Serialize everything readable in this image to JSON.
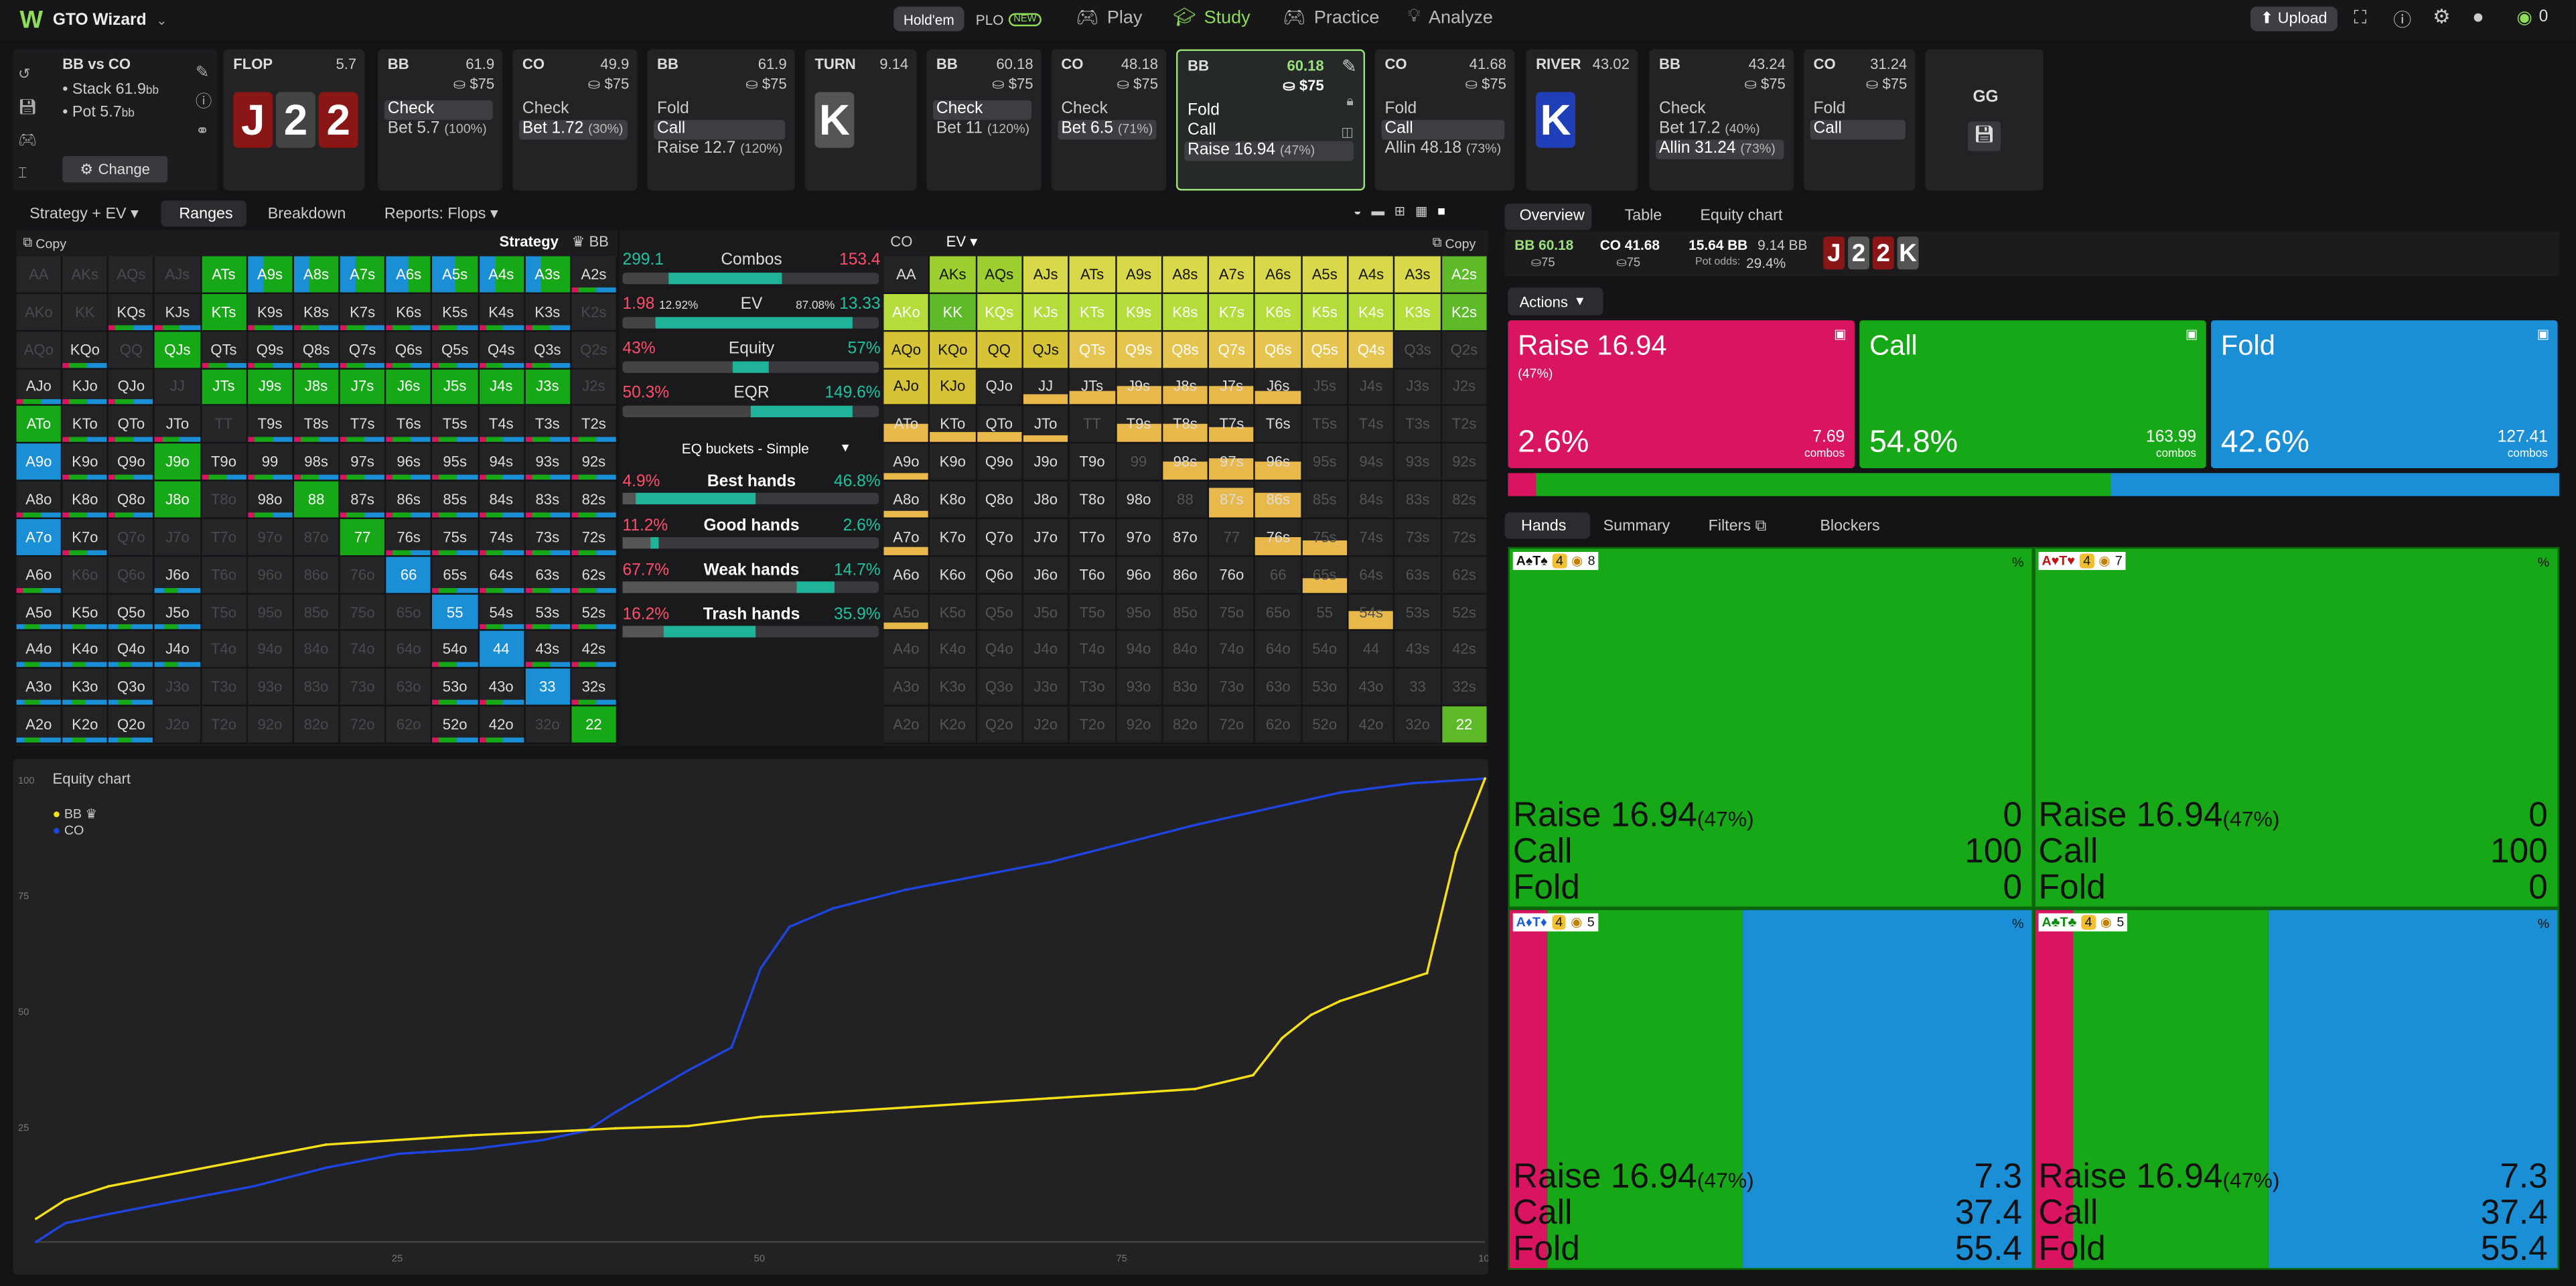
{
  "app": {
    "logo": "W",
    "name": "GTO Wizard",
    "variants": [
      "Hold'em",
      "PLO"
    ],
    "plo_badge": "NEW",
    "nav": [
      "Play",
      "Study",
      "Practice",
      "Analyze"
    ],
    "upload": "Upload",
    "user_count": "0"
  },
  "spot": {
    "title": "BB vs CO",
    "stack": "• Stack 61.9",
    "stack_unit": "bb",
    "pot": "• Pot 5.7",
    "pot_unit": "bb",
    "change": "Change"
  },
  "strip": [
    {
      "h": "FLOP",
      "v": "5.7",
      "board": [
        "J",
        "2",
        "2"
      ],
      "board_colors": [
        "#8b1616",
        "#444",
        "#8b1616"
      ]
    },
    {
      "h": "BB",
      "v": "61.9",
      "pot": "$75",
      "acts": [
        [
          "Check",
          "",
          true
        ],
        [
          "Bet 5.7",
          "(100%)",
          false
        ]
      ]
    },
    {
      "h": "CO",
      "v": "49.9",
      "pot": "$75",
      "acts": [
        [
          "Check",
          "",
          false
        ],
        [
          "Bet 1.72",
          "(30%)",
          true
        ]
      ]
    },
    {
      "h": "BB",
      "v": "61.9",
      "pot": "$75",
      "acts": [
        [
          "Fold",
          "",
          false
        ],
        [
          "Call",
          "",
          true
        ],
        [
          "Raise 12.7",
          "(120%)",
          false
        ]
      ]
    },
    {
      "h": "TURN",
      "v": "9.14",
      "board": [
        "K"
      ],
      "board_colors": [
        "#555"
      ]
    },
    {
      "h": "BB",
      "v": "60.18",
      "pot": "$75",
      "acts": [
        [
          "Check",
          "",
          true
        ],
        [
          "Bet 11",
          "(120%)",
          false
        ]
      ]
    },
    {
      "h": "CO",
      "v": "48.18",
      "pot": "$75",
      "acts": [
        [
          "Check",
          "",
          false
        ],
        [
          "Bet 6.5",
          "(71%)",
          true
        ]
      ]
    },
    {
      "h": "BB",
      "v": "60.18",
      "pot": "$75",
      "acts": [
        [
          "Fold",
          "",
          false
        ],
        [
          "Call",
          "",
          false
        ],
        [
          "Raise 16.94",
          "(47%)",
          true
        ]
      ],
      "sel": true
    },
    {
      "h": "CO",
      "v": "41.68",
      "pot": "$75",
      "acts": [
        [
          "Fold",
          "",
          false
        ],
        [
          "Call",
          "",
          true
        ],
        [
          "Allin 48.18",
          "(73%)",
          false
        ]
      ]
    },
    {
      "h": "RIVER",
      "v": "43.02",
      "board": [
        "K"
      ],
      "board_colors": [
        "#1f3fb8"
      ]
    },
    {
      "h": "BB",
      "v": "43.24",
      "pot": "$75",
      "acts": [
        [
          "Check",
          "",
          false
        ],
        [
          "Bet 17.2",
          "(40%)",
          false
        ],
        [
          "Allin 31.24",
          "(73%)",
          true
        ]
      ]
    },
    {
      "h": "CO",
      "v": "31.24",
      "pot": "$75",
      "acts": [
        [
          "Fold",
          "",
          false
        ],
        [
          "Call",
          "",
          true
        ]
      ]
    },
    {
      "h": "GG",
      "v": "",
      "board": []
    }
  ],
  "left_tabs": {
    "mode": "Strategy + EV",
    "tabs": [
      "Ranges",
      "Breakdown",
      "Reports: Flops"
    ]
  },
  "grid_left": {
    "copy": "Copy",
    "mode": "Strategy",
    "player": "BB"
  },
  "grid_right": {
    "player": "CO",
    "mode": "EV",
    "copy": "Copy"
  },
  "stats": [
    {
      "l": "299.1",
      "m": "Combos",
      "r": "153.4",
      "lc": "#1fc3a0",
      "rc": "#ff4d6a"
    },
    {
      "l": "1.98",
      "lp": "12.92%",
      "m": "EV",
      "rp": "87.08%",
      "r": "13.33",
      "lc": "#ff4d6a",
      "rc": "#1fc3a0"
    },
    {
      "l": "43%",
      "m": "Equity",
      "r": "57%",
      "lc": "#ff4d6a",
      "rc": "#1fc3a0"
    },
    {
      "l": "50.3%",
      "m": "EQR",
      "r": "149.6%",
      "lc": "#ff4d6a",
      "rc": "#1fc3a0"
    }
  ],
  "buckets": {
    "title": "EQ buckets - Simple",
    "rows": [
      [
        "4.9%",
        "Best hands",
        "46.8%"
      ],
      [
        "11.2%",
        "Good hands",
        "2.6%"
      ],
      [
        "67.7%",
        "Weak hands",
        "14.7%"
      ],
      [
        "16.2%",
        "Trash hands",
        "35.9%"
      ]
    ]
  },
  "equity_chart": {
    "title": "Equity chart",
    "legend": [
      "BB",
      "CO"
    ],
    "yticks": [
      "100",
      "75",
      "50",
      "25"
    ],
    "xticks": [
      "25",
      "50",
      "75",
      "100"
    ]
  },
  "chart_data": {
    "type": "line",
    "title": "Equity chart",
    "series": [
      {
        "name": "BB",
        "color": "#f5e016",
        "x": [
          0,
          2,
          5,
          10,
          15,
          20,
          30,
          37,
          40,
          45,
          50,
          55,
          60,
          70,
          75,
          80,
          84,
          86,
          88,
          90,
          96,
          98,
          100
        ],
        "y": [
          5,
          9,
          12,
          15,
          18,
          21,
          23,
          24,
          24.5,
          25,
          27,
          28,
          29,
          31,
          32,
          33,
          36,
          44,
          49,
          52,
          58,
          84,
          100
        ]
      },
      {
        "name": "CO",
        "color": "#1f45e0",
        "x": [
          0,
          2,
          5,
          10,
          15,
          20,
          25,
          30,
          35,
          38,
          40,
          45,
          48,
          50,
          52,
          55,
          60,
          70,
          80,
          90,
          95,
          100
        ],
        "y": [
          0,
          4,
          6,
          9,
          12,
          16,
          19,
          20,
          22,
          24,
          28,
          37,
          42,
          59,
          68,
          72,
          76,
          82,
          90,
          97,
          99,
          100
        ]
      }
    ],
    "xlim": [
      0,
      100
    ],
    "ylim": [
      0,
      100
    ]
  },
  "right_tabs": {
    "tabs": [
      "Overview",
      "Table",
      "Equity chart"
    ]
  },
  "summary": {
    "bb": "BB 60.18",
    "bb_sub": "75",
    "co": "CO 41.68",
    "co_sub": "75",
    "pot": "15.64 BB",
    "tocall": "9.14 BB",
    "odds_label": "Pot odds:",
    "odds": "29.4%",
    "board": [
      "J",
      "2",
      "2",
      "K"
    ]
  },
  "actions_label": "Actions",
  "actions": [
    {
      "name": "Raise 16.94",
      "sub": "(47%)",
      "pct": "2.6%",
      "combos": "7.69",
      "color": "#d91460",
      "share": 2.6
    },
    {
      "name": "Call",
      "sub": "",
      "pct": "54.8%",
      "combos": "163.99",
      "color": "#17a817",
      "share": 54.8
    },
    {
      "name": "Fold",
      "sub": "",
      "pct": "42.6%",
      "combos": "127.41",
      "color": "#1b8fd6",
      "share": 42.6
    }
  ],
  "combos_label": "combos",
  "hand_tabs": [
    "Hands",
    "Summary",
    "Filters",
    "Blockers"
  ],
  "hands": [
    {
      "card": "A♠T♠",
      "suitc": "#111",
      "pot": "4",
      "k": "8",
      "mix": [
        0,
        100,
        0
      ],
      "vals": [
        "0",
        "100",
        "0"
      ]
    },
    {
      "card": "A♥T♥",
      "suitc": "#c01010",
      "pot": "4",
      "k": "7",
      "mix": [
        0,
        100,
        0
      ],
      "vals": [
        "0",
        "100",
        "0"
      ]
    },
    {
      "card": "A♦T♦",
      "suitc": "#1b5fd6",
      "pot": "4",
      "k": "5",
      "mix": [
        7.3,
        37.4,
        55.4
      ],
      "vals": [
        "7.3",
        "37.4",
        "55.4"
      ]
    },
    {
      "card": "A♣T♣",
      "suitc": "#0a8a0a",
      "pot": "4",
      "k": "5",
      "mix": [
        7.3,
        37.4,
        55.4
      ],
      "vals": [
        "7.3",
        "37.4",
        "55.4"
      ]
    }
  ],
  "hand_action_labels": [
    "Raise 16.94",
    "Call",
    "Fold"
  ],
  "hand_action_sub": "(47%)",
  "pct_sign": "%"
}
